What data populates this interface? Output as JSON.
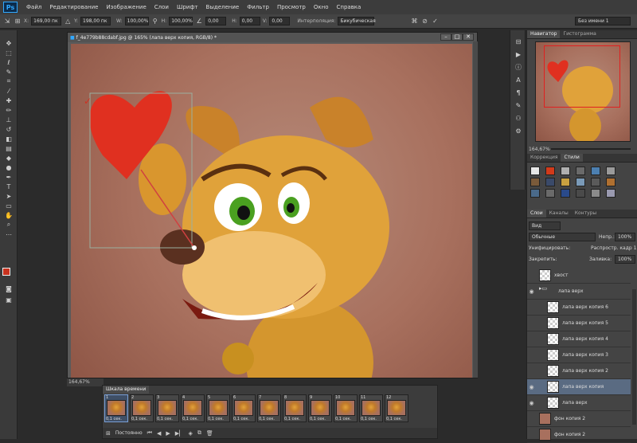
{
  "app": {
    "logo": "Ps"
  },
  "menu": [
    "Файл",
    "Редактирование",
    "Изображение",
    "Слои",
    "Шрифт",
    "Выделение",
    "Фильтр",
    "Просмотр",
    "Окно",
    "Справка"
  ],
  "options": {
    "x_label": "X:",
    "x_value": "169,00 пк",
    "y_label": "Y:",
    "y_value": "198,00 пк",
    "w_label": "W:",
    "w_value": "100,00%",
    "h_label": "H:",
    "h_value": "100,00%",
    "angle_value": "0,00",
    "hskew_label": "H:",
    "hskew_value": "0,00",
    "vskew_label": "V:",
    "vskew_value": "0,00",
    "interp_label": "Интерполяция:",
    "interp_value": "Бикубическая",
    "workspace": "Без имени 1"
  },
  "document": {
    "tab_title": "f_4e779b88cdabf.jpg @ 165% (лапа верх копия, RGB/8) *",
    "zoom": "164,67%"
  },
  "navigator": {
    "tabs": [
      "Навигатор",
      "Гистограмма"
    ],
    "zoom": "164,67%"
  },
  "swatches_panel": {
    "tabs": [
      "Коррекция",
      "Стили"
    ],
    "colors": [
      "#e6e6e6",
      "#d23a1a",
      "#b0b0b0",
      "#6a6a6a",
      "#4c7fb0",
      "#9a9a9a",
      "#7a5a3a",
      "#3a4a6a",
      "#c8a040",
      "#7a9ab8",
      "#5a5a5a",
      "#b07030",
      "#4a6a8a",
      "#6a6a6a",
      "#2a4a8a",
      "#4a4a4a",
      "#8a8a8a",
      "#9a9ab0"
    ]
  },
  "layers": {
    "tabs": [
      "Слои",
      "Каналы",
      "Контуры"
    ],
    "kind": "Вид",
    "blend": "Обычные",
    "opacity_label": "Непр.:",
    "opacity_value": "100%",
    "unify_label": "Унифицировать:",
    "propagate_label": "Распростр. кадр 1",
    "lock_label": "Закрепить:",
    "fill_label": "Заливка:",
    "fill_value": "100%",
    "rows": [
      {
        "name": "хвост",
        "indent": 0,
        "thumb": "trans",
        "eye": "",
        "selected": false
      },
      {
        "name": "лапа верх",
        "indent": 0,
        "thumb": "folder",
        "eye": "◉",
        "selected": false
      },
      {
        "name": "лапа верх копия 6",
        "indent": 1,
        "thumb": "trans",
        "eye": "",
        "selected": false
      },
      {
        "name": "лапа верх копия 5",
        "indent": 1,
        "thumb": "trans",
        "eye": "",
        "selected": false
      },
      {
        "name": "лапа верх копия 4",
        "indent": 1,
        "thumb": "trans",
        "eye": "",
        "selected": false
      },
      {
        "name": "лапа верх копия 3",
        "indent": 1,
        "thumb": "trans",
        "eye": "",
        "selected": false
      },
      {
        "name": "лапа верх копия 2",
        "indent": 1,
        "thumb": "trans",
        "eye": "",
        "selected": false
      },
      {
        "name": "лапа верх копия",
        "indent": 1,
        "thumb": "trans",
        "eye": "◉",
        "selected": true
      },
      {
        "name": "лапа верх",
        "indent": 1,
        "thumb": "trans",
        "eye": "◉",
        "selected": false
      },
      {
        "name": "фон копия 2",
        "indent": 0,
        "thumb": "img",
        "eye": "",
        "selected": false
      },
      {
        "name": "фон копия 2",
        "indent": 0,
        "thumb": "img",
        "eye": "",
        "selected": false
      }
    ]
  },
  "timeline": {
    "title": "Шкала времени",
    "frames": [
      {
        "n": "1",
        "dur": "0,1 сек."
      },
      {
        "n": "2",
        "dur": "0,1 сек."
      },
      {
        "n": "3",
        "dur": "0,1 сек."
      },
      {
        "n": "4",
        "dur": "0,1 сек."
      },
      {
        "n": "5",
        "dur": "0,1 сек."
      },
      {
        "n": "6",
        "dur": "0,1 сек."
      },
      {
        "n": "7",
        "dur": "0,1 сек."
      },
      {
        "n": "8",
        "dur": "0,1 сек."
      },
      {
        "n": "9",
        "dur": "0,1 сек."
      },
      {
        "n": "10",
        "dur": "0,1 сек."
      },
      {
        "n": "11",
        "dur": "0,1 сек."
      },
      {
        "n": "12",
        "dur": "0,1 сек."
      }
    ],
    "loop": "Постоянно"
  }
}
